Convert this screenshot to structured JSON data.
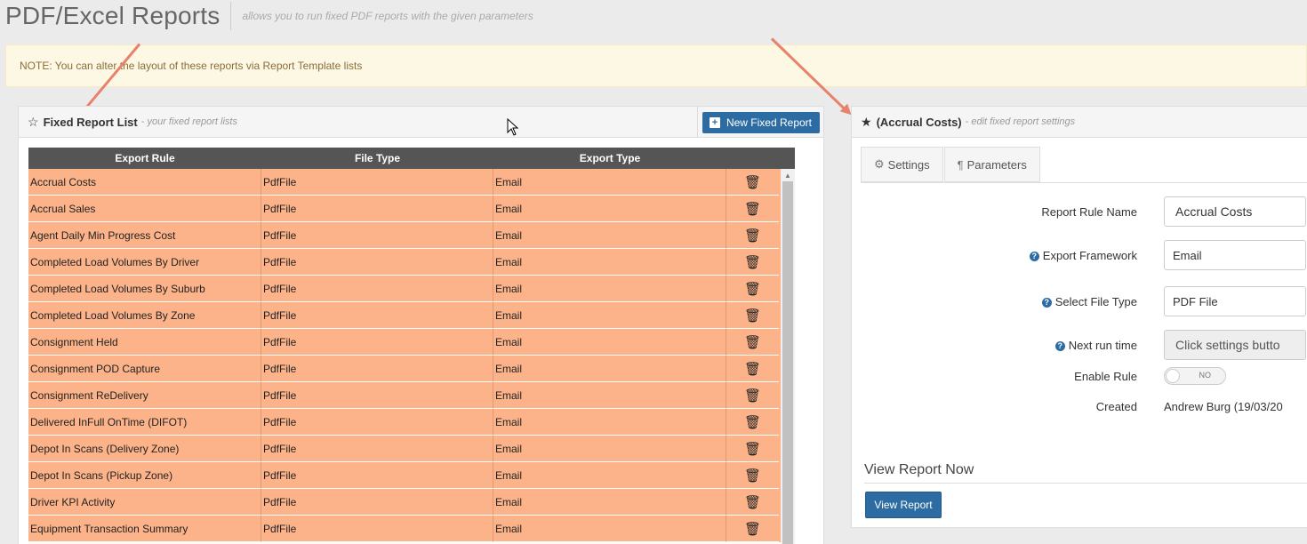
{
  "page": {
    "title": "PDF/Excel Reports",
    "subtitle": "allows you to run fixed PDF reports with the given parameters",
    "note": "NOTE: You can alter the layout of these reports via Report Template lists"
  },
  "left_panel": {
    "title": "Fixed Report List",
    "hint": "- your fixed report lists",
    "new_button": "New Fixed Report",
    "columns": [
      "Export Rule",
      "File Type",
      "Export Type"
    ],
    "rows": [
      {
        "rule": "Accrual Costs",
        "file_type": "PdfFile",
        "export_type": "Email"
      },
      {
        "rule": "Accrual Sales",
        "file_type": "PdfFile",
        "export_type": "Email"
      },
      {
        "rule": "Agent Daily Min Progress Cost",
        "file_type": "PdfFile",
        "export_type": "Email"
      },
      {
        "rule": "Completed Load Volumes By Driver",
        "file_type": "PdfFile",
        "export_type": "Email"
      },
      {
        "rule": "Completed Load Volumes By Suburb",
        "file_type": "PdfFile",
        "export_type": "Email"
      },
      {
        "rule": "Completed Load Volumes By Zone",
        "file_type": "PdfFile",
        "export_type": "Email"
      },
      {
        "rule": "Consignment Held",
        "file_type": "PdfFile",
        "export_type": "Email"
      },
      {
        "rule": "Consignment POD Capture",
        "file_type": "PdfFile",
        "export_type": "Email"
      },
      {
        "rule": "Consignment ReDelivery",
        "file_type": "PdfFile",
        "export_type": "Email"
      },
      {
        "rule": "Delivered InFull OnTime (DIFOT)",
        "file_type": "PdfFile",
        "export_type": "Email"
      },
      {
        "rule": "Depot In Scans (Delivery Zone)",
        "file_type": "PdfFile",
        "export_type": "Email"
      },
      {
        "rule": "Depot In Scans (Pickup Zone)",
        "file_type": "PdfFile",
        "export_type": "Email"
      },
      {
        "rule": "Driver KPI Activity",
        "file_type": "PdfFile",
        "export_type": "Email"
      },
      {
        "rule": "Equipment Transaction Summary",
        "file_type": "PdfFile",
        "export_type": "Email"
      }
    ]
  },
  "right_panel": {
    "title": "(Accrual Costs)",
    "hint": "- edit fixed report settings",
    "tabs": {
      "settings": "Settings",
      "parameters": "Parameters"
    },
    "fields": {
      "rule_name_label": "Report Rule Name",
      "rule_name_value": "Accrual Costs",
      "framework_label": "Export Framework",
      "framework_value": "Email",
      "file_type_label": "Select File Type",
      "file_type_value": "PDF File",
      "next_run_label": "Next run time",
      "next_run_value": "Click settings butto",
      "enable_label": "Enable Rule",
      "enable_value": "NO",
      "created_label": "Created",
      "created_value": "Andrew Burg (19/03/20"
    },
    "view_now_title": "View Report Now",
    "view_button": "View Report"
  }
}
